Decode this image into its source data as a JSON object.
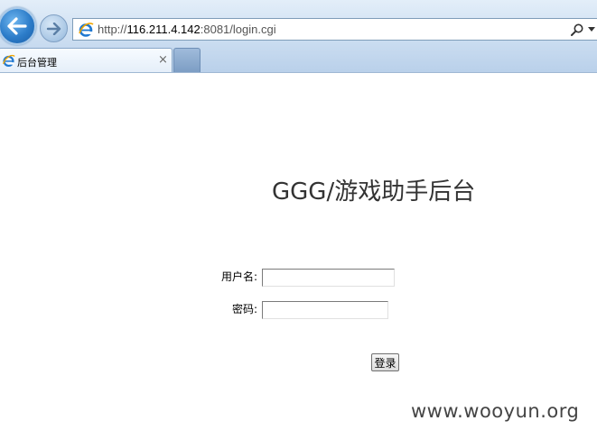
{
  "browser": {
    "address_bar": {
      "url_prefix": "http://",
      "url_host": "116.211.4.142",
      "url_suffix": ":8081/login.cgi"
    },
    "tab": {
      "title": "后台管理",
      "close_glyph": "×"
    },
    "icons": {
      "back": "back-arrow-icon",
      "forward": "forward-arrow-icon",
      "page": "ie-logo-icon",
      "search": "search-icon"
    },
    "colors": {
      "chrome_blue": "#2c7cc9",
      "chrome_bg": "#cfe0f2"
    }
  },
  "page": {
    "title": "GGG/游戏助手后台",
    "form": {
      "username_label": "用户名:",
      "username_value": "",
      "password_label": "密码:",
      "password_value": "",
      "submit_label": "登录"
    }
  },
  "watermark": "www.wooyun.org"
}
